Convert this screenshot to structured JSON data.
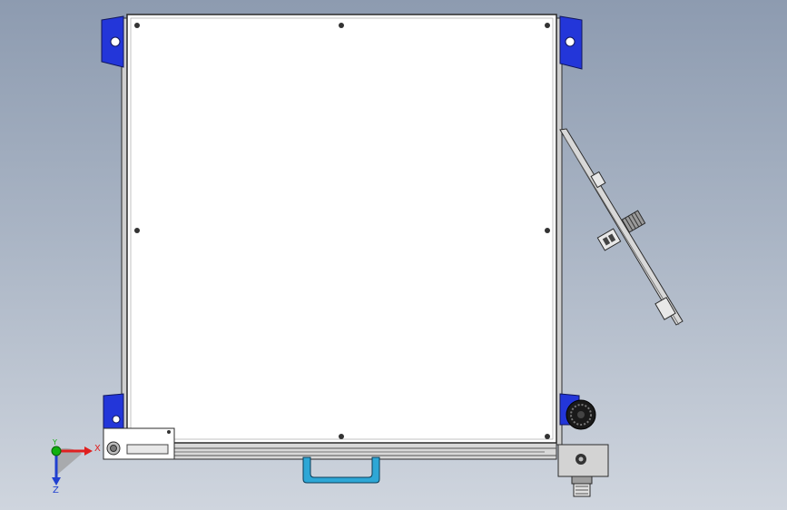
{
  "viewport": {
    "background_top": "#8d9bb0",
    "background_bottom": "#cfd5de"
  },
  "model": {
    "panel_color": "#ffffff",
    "outline_color": "#2b2b2b",
    "bracket_color": "#2336d9",
    "handle_color": "#2ea7d6",
    "frame_color": "#c9c9c9"
  },
  "triad": {
    "x_label": "X",
    "y_label": "Y",
    "z_label": "Z",
    "x_color": "#e02020",
    "y_color": "#10b010",
    "z_color": "#2040d0"
  }
}
